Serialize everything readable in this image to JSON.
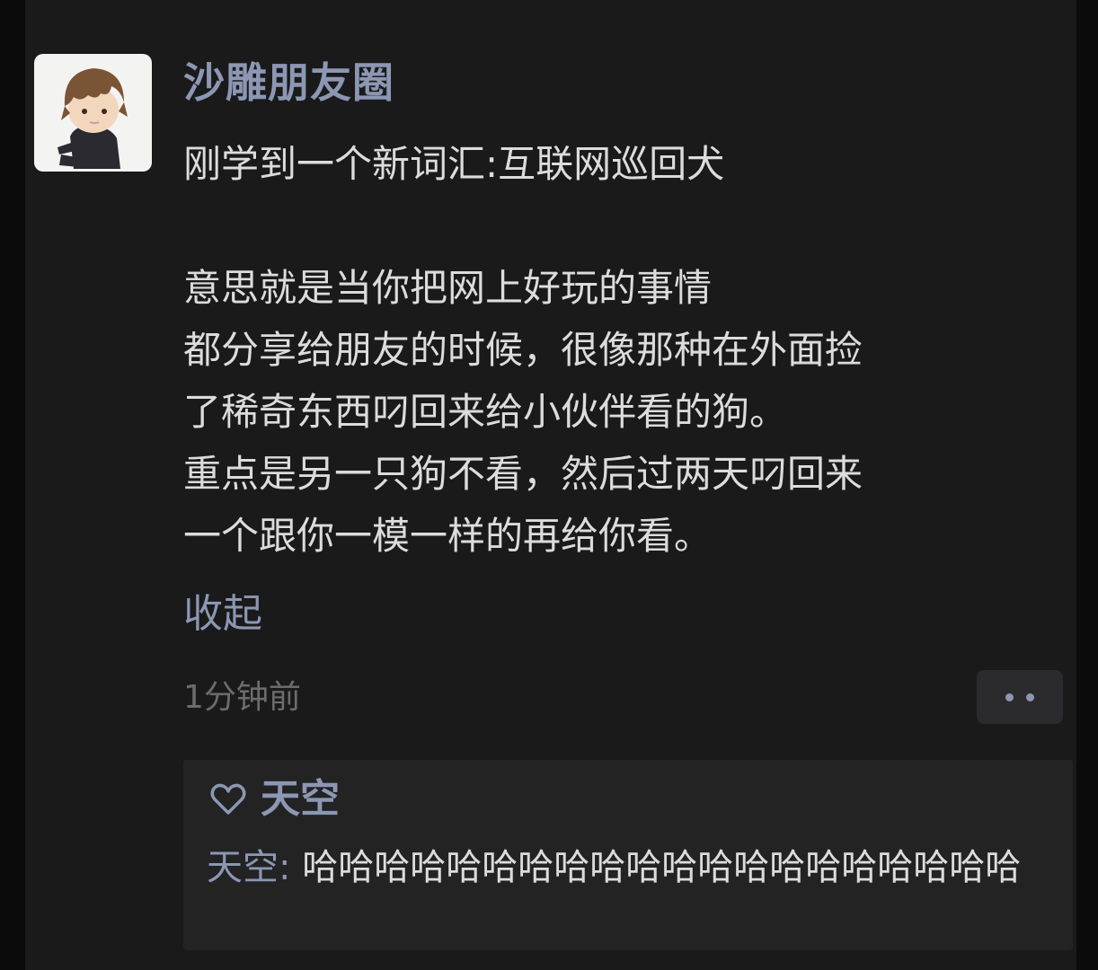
{
  "post": {
    "username": "沙雕朋友圈",
    "text": "刚学到一个新词汇:互联网巡回犬\n\n意思就是当你把网上好玩的事情\n都分享给朋友的时候，很像那种在外面捡\n了稀奇东西叼回来给小伙伴看的狗。\n重点是另一只狗不看，然后过两天叼回来\n一个跟你一模一样的再给你看。",
    "collapse_label": "收起",
    "timestamp": "1分钟前"
  },
  "likes": {
    "icon": "heart-icon",
    "names": "天空"
  },
  "comments": [
    {
      "author": "天空",
      "separator": ": ",
      "text": "哈哈哈哈哈哈哈哈哈哈哈哈哈哈哈哈哈哈哈哈"
    }
  ],
  "colors": {
    "background": "#1a1a1b",
    "link": "#8c97b3",
    "text": "#dcdcdc",
    "muted": "#6c6c6c",
    "panel": "#232324"
  }
}
